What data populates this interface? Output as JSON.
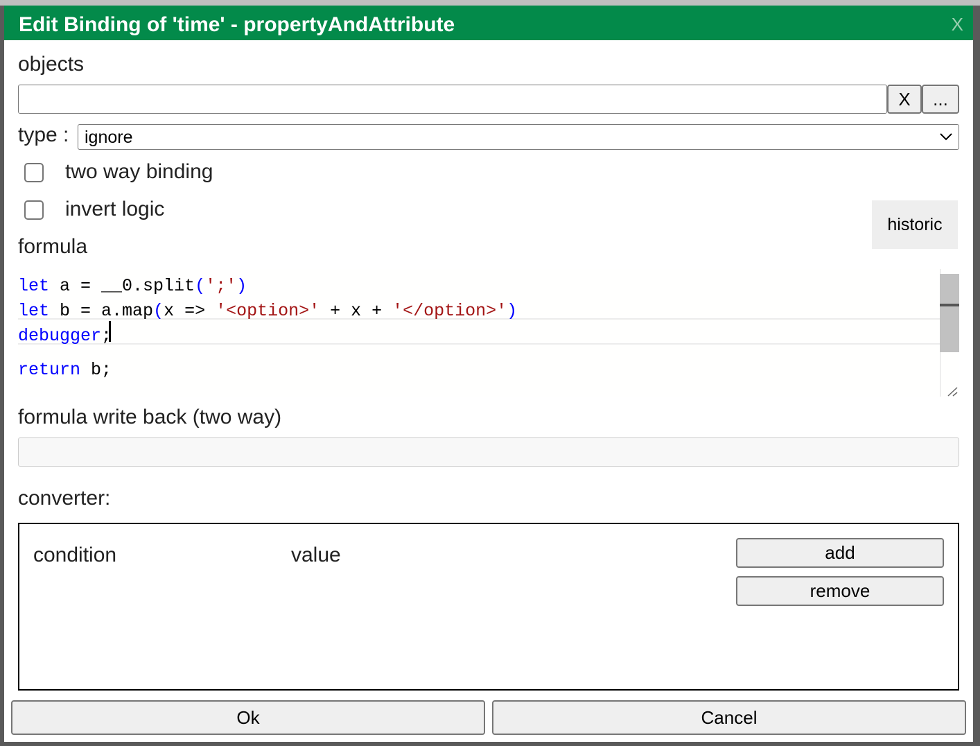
{
  "dialog": {
    "title": "Edit Binding of 'time' - propertyAndAttribute",
    "close_label": "X",
    "objects_label": "objects",
    "objects_value": "",
    "objects_clear_label": "X",
    "objects_browse_label": "...",
    "type_label": "type :",
    "type_value": "ignore",
    "two_way_label": "two way binding",
    "two_way_checked": false,
    "invert_label": "invert logic",
    "invert_checked": false,
    "historic_label": "historic",
    "formula_label": "formula",
    "formula_lines": [
      [
        {
          "t": "let",
          "c": "kw"
        },
        {
          "t": " a = __0.split",
          "c": "id"
        },
        {
          "t": "(",
          "c": "kw"
        },
        {
          "t": "';'",
          "c": "st"
        },
        {
          "t": ")",
          "c": "kw"
        }
      ],
      [
        {
          "t": "let",
          "c": "kw"
        },
        {
          "t": " b = a.map",
          "c": "id"
        },
        {
          "t": "(",
          "c": "kw"
        },
        {
          "t": "x => ",
          "c": "id"
        },
        {
          "t": "'<option>'",
          "c": "st"
        },
        {
          "t": " + x + ",
          "c": "id"
        },
        {
          "t": "'</option>'",
          "c": "st"
        },
        {
          "t": ")",
          "c": "kw"
        }
      ],
      [
        {
          "t": "debugger",
          "c": "kw"
        },
        {
          "t": ";",
          "c": "id"
        }
      ],
      [
        {
          "t": "return",
          "c": "kw"
        },
        {
          "t": " b;",
          "c": "id"
        }
      ]
    ],
    "writeback_label": "formula write back (two way)",
    "writeback_value": "",
    "converter_label": "converter:",
    "converter_condition_header": "condition",
    "converter_value_header": "value",
    "add_label": "add",
    "remove_label": "remove",
    "ok_label": "Ok",
    "cancel_label": "Cancel",
    "accent_color": "#038a4a"
  }
}
